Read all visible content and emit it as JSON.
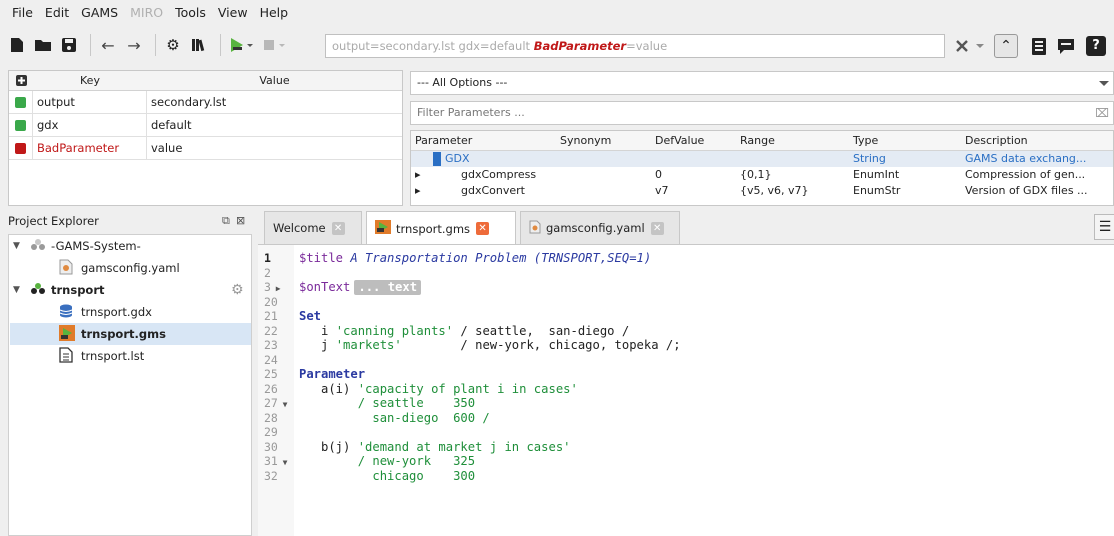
{
  "menu": [
    "File",
    "Edit",
    "GAMS",
    "MIRO",
    "Tools",
    "View",
    "Help"
  ],
  "toolbar": {
    "cmd_prefix": "output=secondary.lst gdx=default ",
    "cmd_bad": "BadParameter",
    "cmd_suffix": "=value"
  },
  "options_table": {
    "header_key": "Key",
    "header_value": "Value",
    "rows": [
      {
        "key": "output",
        "value": "secondary.lst",
        "status_color": "#3aa84a"
      },
      {
        "key": "gdx",
        "value": "default",
        "status_color": "#3aa84a"
      },
      {
        "key": "BadParameter",
        "value": "value",
        "status_color": "#c01818"
      }
    ]
  },
  "option_browser": {
    "category": "--- All Options ---",
    "filter_placeholder": "Filter Parameters ...",
    "columns": [
      "Parameter",
      "Synonym",
      "DefValue",
      "Range",
      "Type",
      "Description"
    ],
    "rows": [
      {
        "name": "GDX",
        "synonym": "",
        "default": "",
        "range": "",
        "type": "String",
        "description": "GAMS data exchang..."
      },
      {
        "name": "gdxCompress",
        "synonym": "",
        "default": "0",
        "range": "{0,1}",
        "type": "EnumInt",
        "description": "Compression of gen..."
      },
      {
        "name": "gdxConvert",
        "synonym": "",
        "default": "v7",
        "range": "{v5, v6, v7}",
        "type": "EnumStr",
        "description": "Version of GDX files ..."
      }
    ]
  },
  "project_explorer": {
    "title": "Project Explorer",
    "items": [
      {
        "label": "-GAMS-System-",
        "bold": false
      },
      {
        "label": "gamsconfig.yaml",
        "bold": false
      },
      {
        "label": "trnsport",
        "bold": true
      },
      {
        "label": "trnsport.gdx",
        "bold": false
      },
      {
        "label": "trnsport.gms",
        "bold": true
      },
      {
        "label": "trnsport.lst",
        "bold": false
      }
    ]
  },
  "tabs": [
    "Welcome",
    "trnsport.gms",
    "gamsconfig.yaml"
  ],
  "editor": {
    "line_numbers": [
      "1",
      "2",
      "3",
      "20",
      "21",
      "22",
      "23",
      "24",
      "25",
      "26",
      "27",
      "28",
      "29",
      "30",
      "31",
      "32"
    ],
    "fold_label": "... text",
    "l1_dir": "$title",
    "l1_title": "A Transportation Problem (TRNSPORT,SEQ=1)",
    "l3_dir": "$onText",
    "l21_kw": "Set",
    "l22_id": "   i ",
    "l22_str": "'canning plants'",
    "l22_rest": " / seattle,  san-diego /",
    "l23_id": "   j ",
    "l23_str": "'markets'",
    "l23_rest": "        / new-york, chicago, topeka /;",
    "l25_kw": "Parameter",
    "l26_id": "   a(i) ",
    "l26_str": "'capacity of plant i in cases'",
    "l27": "        / seattle    350",
    "l28": "          san-diego  600 /",
    "l30_id": "   b(j) ",
    "l30_str": "'demand at market j in cases'",
    "l31": "        / new-york   325",
    "l32": "          chicago    300"
  }
}
